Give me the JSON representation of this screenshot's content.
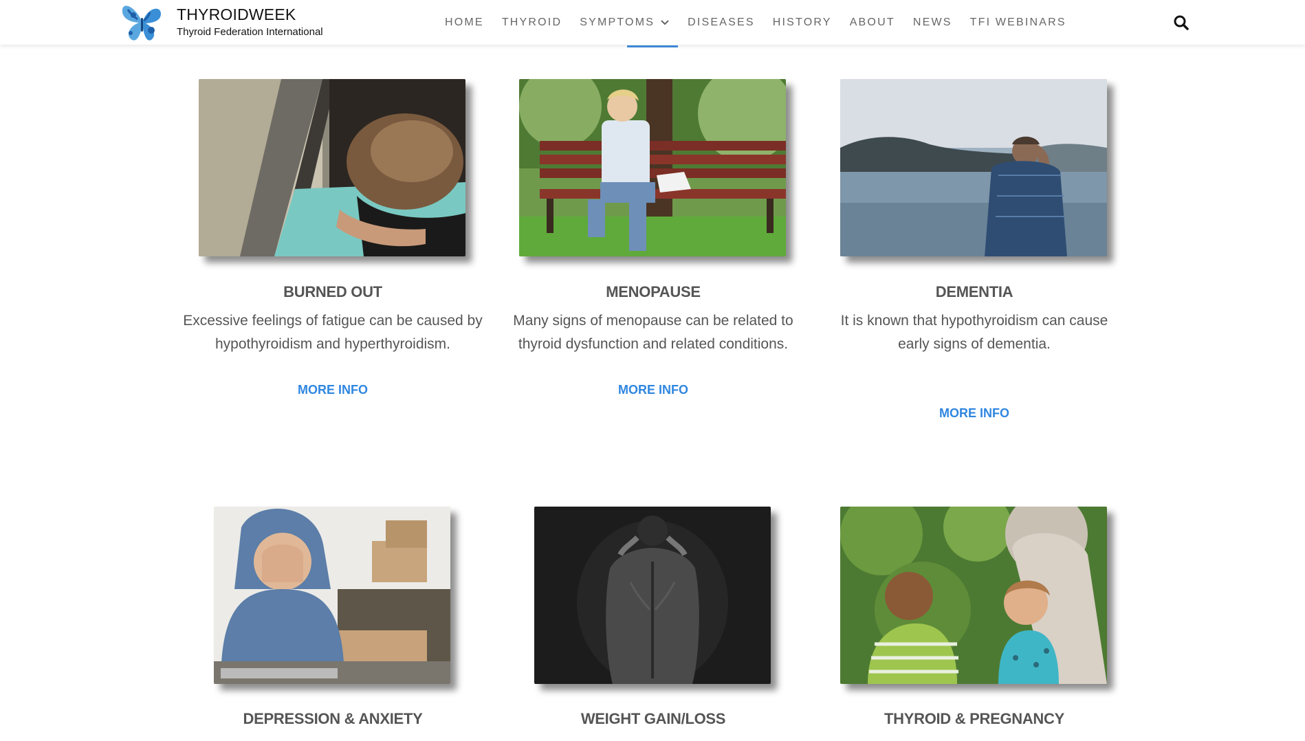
{
  "header": {
    "site_title": "THYROIDWEEK",
    "site_tagline": "Thyroid Federation International",
    "logo_icon": "butterfly-logo-icon",
    "search_icon": "search-icon"
  },
  "nav": {
    "items": [
      {
        "label": "HOME"
      },
      {
        "label": "THYROID"
      },
      {
        "label": "SYMPTOMS"
      },
      {
        "label": "DISEASES"
      },
      {
        "label": "HISTORY"
      },
      {
        "label": "ABOUT"
      },
      {
        "label": "NEWS"
      },
      {
        "label": "TFI WEBINARS"
      }
    ],
    "active_color": "#3d88d8"
  },
  "cards": [
    {
      "title": "BURNED OUT",
      "description_lines": [
        "Excessive feelings of fatigue can be caused by",
        "hypothyroidism and hyperthyroidism."
      ],
      "link": "MORE INFO",
      "image": "woman-sleeping-on-train-photo"
    },
    {
      "title": "MENOPAUSE",
      "description_lines": [
        "Many signs of menopause can be related to",
        "thyroid dysfunction and related conditions."
      ],
      "link": "MORE INFO",
      "image": "woman-on-park-bench-photo"
    },
    {
      "title": "DEMENTIA",
      "description_lines": [
        "It is known that hypothyroidism can cause",
        "early signs of dementia."
      ],
      "link": "MORE INFO",
      "image": "man-looking-at-lake-photo"
    },
    {
      "title": "DEPRESSION & ANXIETY",
      "image": "man-in-hoodie-covering-face-photo"
    },
    {
      "title": "WEIGHT GAIN/LOSS",
      "image": "thin-back-dark-photo"
    },
    {
      "title": "THYROID & PREGNANCY",
      "image": "children-in-garden-photo"
    }
  ],
  "colors": {
    "link": "#2f86e0",
    "heading": "#555555",
    "nav_text": "#666666"
  }
}
